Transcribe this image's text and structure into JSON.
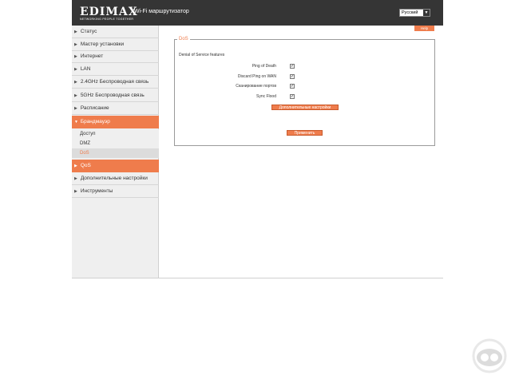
{
  "header": {
    "logo": "EDIMAX",
    "logo_tagline": "NETWORKING PEOPLE TOGETHER",
    "app_title": "Wi-Fi маршрутизатор",
    "language": "Русский"
  },
  "help_label": "Help",
  "sidebar": {
    "items": [
      {
        "label": "Статус"
      },
      {
        "label": "Мастер установки"
      },
      {
        "label": "Интернет"
      },
      {
        "label": "LAN"
      },
      {
        "label": "2.4GHz Беспроводная связь"
      },
      {
        "label": "5GHz Беспроводная связь"
      },
      {
        "label": "Расписание"
      },
      {
        "label": "Брандмауэр"
      },
      {
        "label": "QoS"
      },
      {
        "label": "Дополнительные настройки"
      },
      {
        "label": "Инструменты"
      }
    ],
    "firewall_subitems": [
      {
        "label": "Доступ"
      },
      {
        "label": "DMZ"
      },
      {
        "label": "DoS"
      }
    ]
  },
  "dos": {
    "legend": "DoS",
    "section_label": "Denial of Service features",
    "rows": [
      {
        "label": "Ping of Death",
        "checked": true
      },
      {
        "label": "Discard Ping on WAN",
        "checked": true
      },
      {
        "label": "Сканирование портов",
        "checked": true
      },
      {
        "label": "Sync Flood",
        "checked": true
      }
    ],
    "advanced_button": "Дополнительные настройки",
    "apply_button": "Применить"
  },
  "colors": {
    "accent": "#ef7c4c",
    "header_bg": "#353535",
    "sidebar_bg": "#efefef"
  },
  "icons": {
    "collapsed_arrow": "triangle-right",
    "expanded_arrow": "triangle-down",
    "checkbox": "check-mark"
  }
}
